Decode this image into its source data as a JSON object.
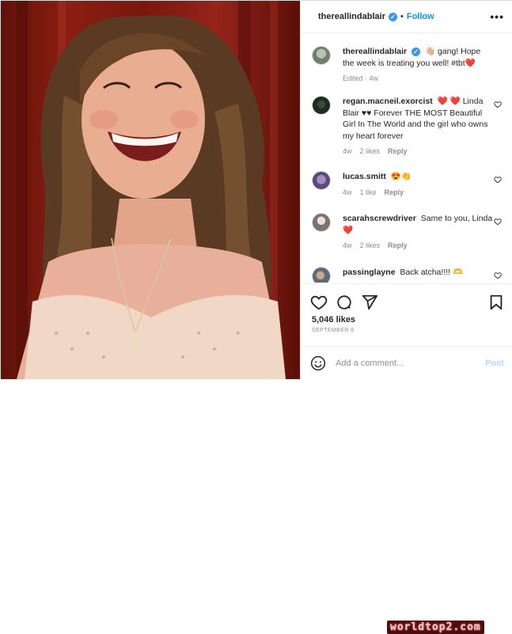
{
  "post": {
    "author": "thereallindablair",
    "verified_mark": "✓",
    "separator": "•",
    "follow_label": "Follow",
    "more_icon": "more-horizontal-icon",
    "photo_description_icon": "post-photo"
  },
  "caption": {
    "username": "thereallindablair",
    "text": "👋🏼 gang! Hope the week is treating you well! #tbt❤️",
    "edited": "Edited · 4w"
  },
  "comments": [
    {
      "username": "regan.macneil.exorcist",
      "text": "❤️ ❤️ Linda Blair ♥♥ Forever THE MOST Beautiful Girl In The World and the girl who owns my heart forever",
      "time": "4w",
      "likes": "2 likes",
      "reply": "Reply"
    },
    {
      "username": "lucas.smitt",
      "text": "😍👏",
      "time": "4w",
      "likes": "1 like",
      "reply": "Reply"
    },
    {
      "username": "scarahscrewdriver",
      "text": "Same to you, Linda ❤️",
      "time": "4w",
      "likes": "2 likes",
      "reply": "Reply"
    },
    {
      "username": "passinglayne",
      "text": "Back atcha!!!! 🫶"
    }
  ],
  "actions": {
    "like_icon": "heart-icon",
    "comment_icon": "comment-icon",
    "share_icon": "share-icon",
    "save_icon": "bookmark-icon",
    "likes": "5,046 likes",
    "date": "SEPTEMBER 8"
  },
  "add_comment": {
    "placeholder": "Add a comment...",
    "post_label": "Post",
    "emoji_icon": "smiley-icon"
  },
  "watermark": "worldtop2.com",
  "colors": {
    "accent": "#0095f6",
    "verified": "#3897f0",
    "heart": "#ed4956",
    "muted": "#8e8e8e",
    "curtain": "#8c1e12"
  }
}
